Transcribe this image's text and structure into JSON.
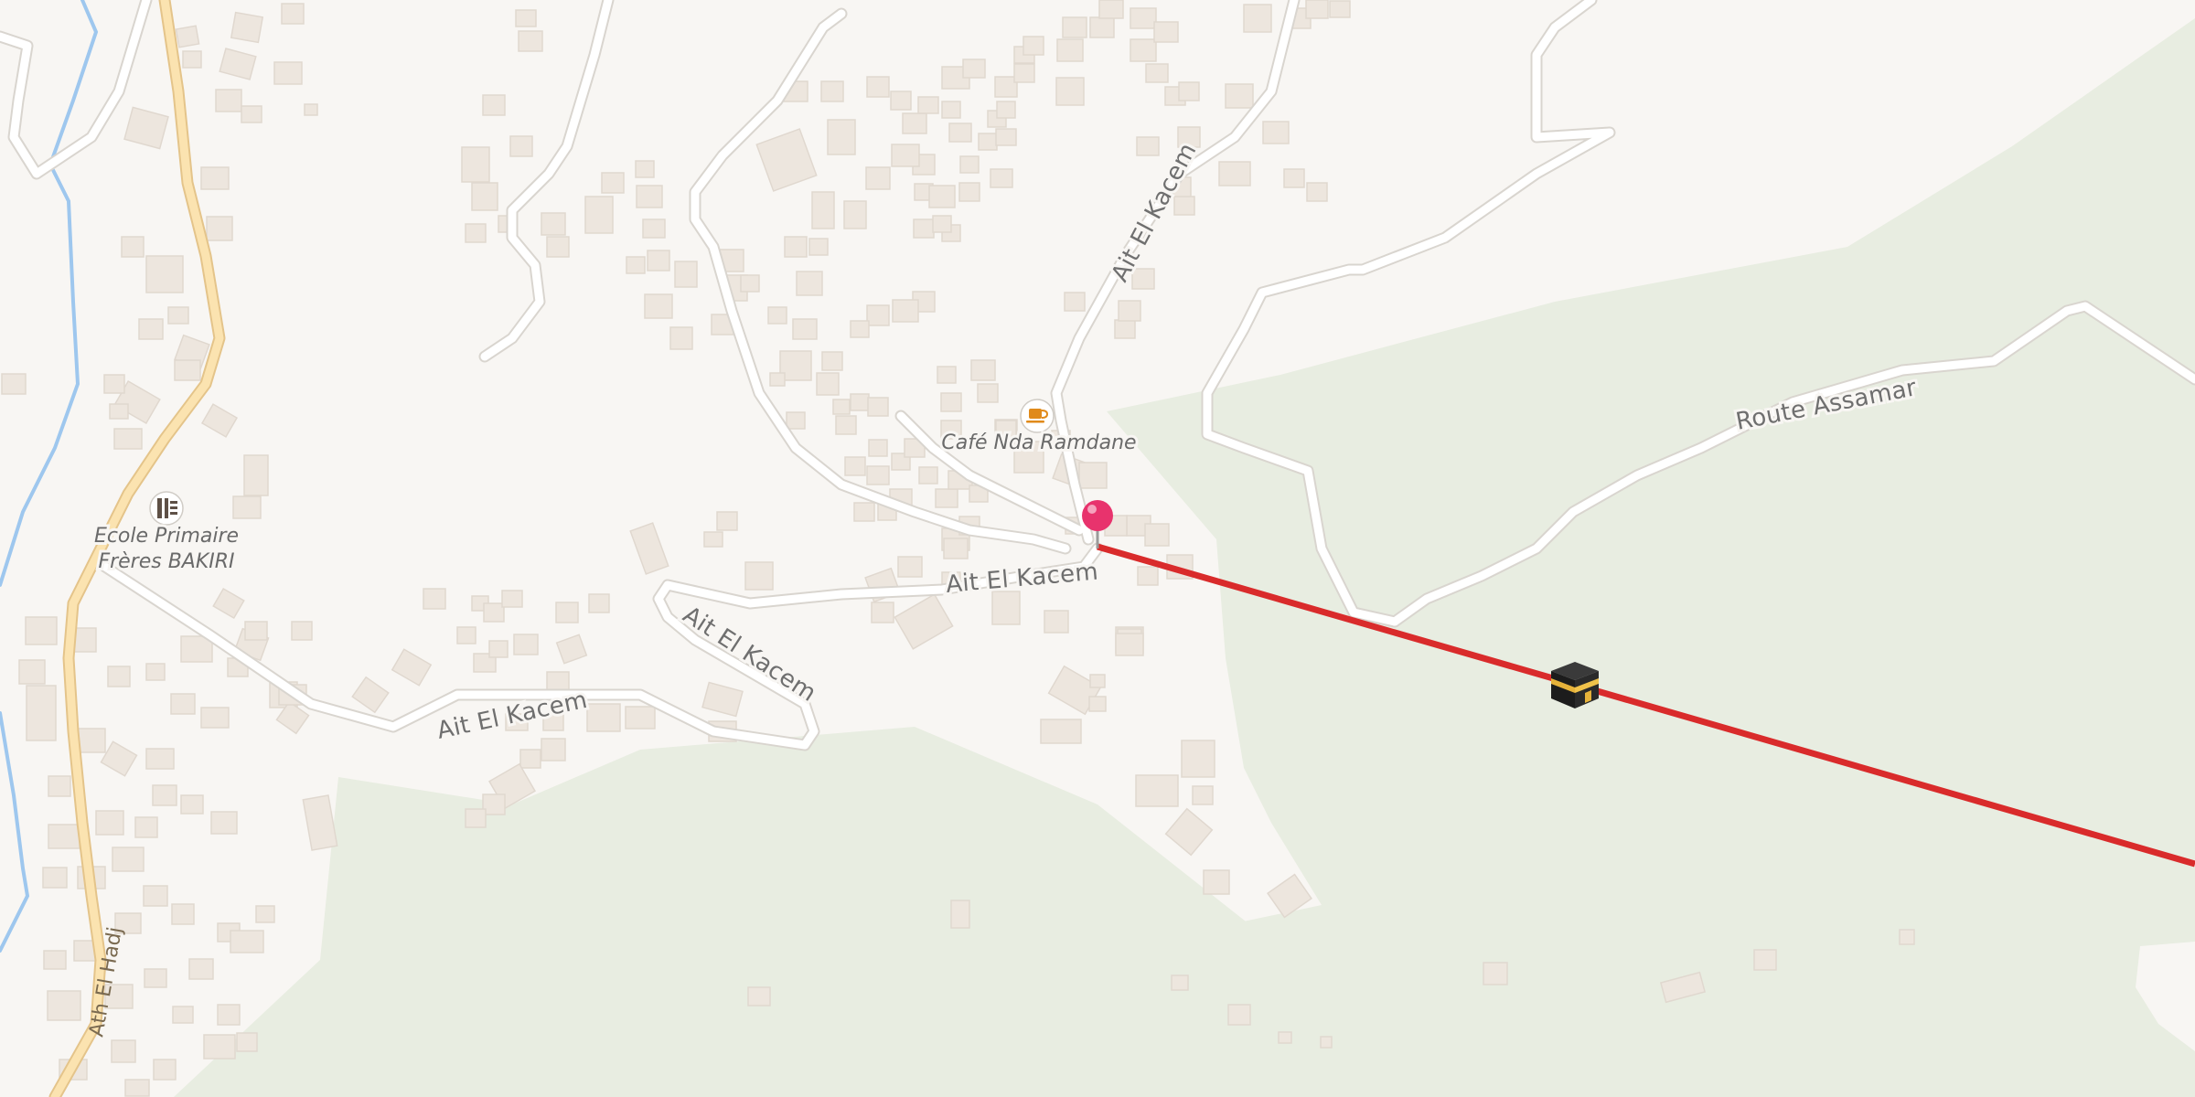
{
  "map": {
    "colors": {
      "background": "#f8f6f3",
      "vegetation": "#e8ede1",
      "building": "#ede6de",
      "road": "#ffffff",
      "road_casing": "#dcd8d2",
      "highway": "#fbe3b0",
      "highway_casing": "#e4c48a",
      "river": "#9ec7ee",
      "route_line": "#d92b2b",
      "pin": "#e8336d"
    },
    "roads": [
      {
        "name": "Ait El Kacem",
        "label": "Ait El Kacem"
      },
      {
        "name": "Ait El Kacem",
        "label": "Ait El Kacem"
      },
      {
        "name": "Ait El Kacem",
        "label": "Ait El Kacem"
      },
      {
        "name": "Ait El Kacem",
        "label": "Ait El Kacem"
      },
      {
        "name": "Route Assamar",
        "label": "Route Assamar"
      },
      {
        "name": "Ath El Hadj",
        "label": "Ath El Hadj"
      }
    ],
    "pois": [
      {
        "name": "Café Nda Ramdane",
        "icon": "cafe-icon"
      },
      {
        "name_line1": "Ecole Primaire",
        "name_line2": "Frères BAKIRI",
        "icon": "school-icon"
      }
    ],
    "markers": {
      "pin": "location-pin-icon",
      "destination": "kaaba-icon"
    }
  }
}
